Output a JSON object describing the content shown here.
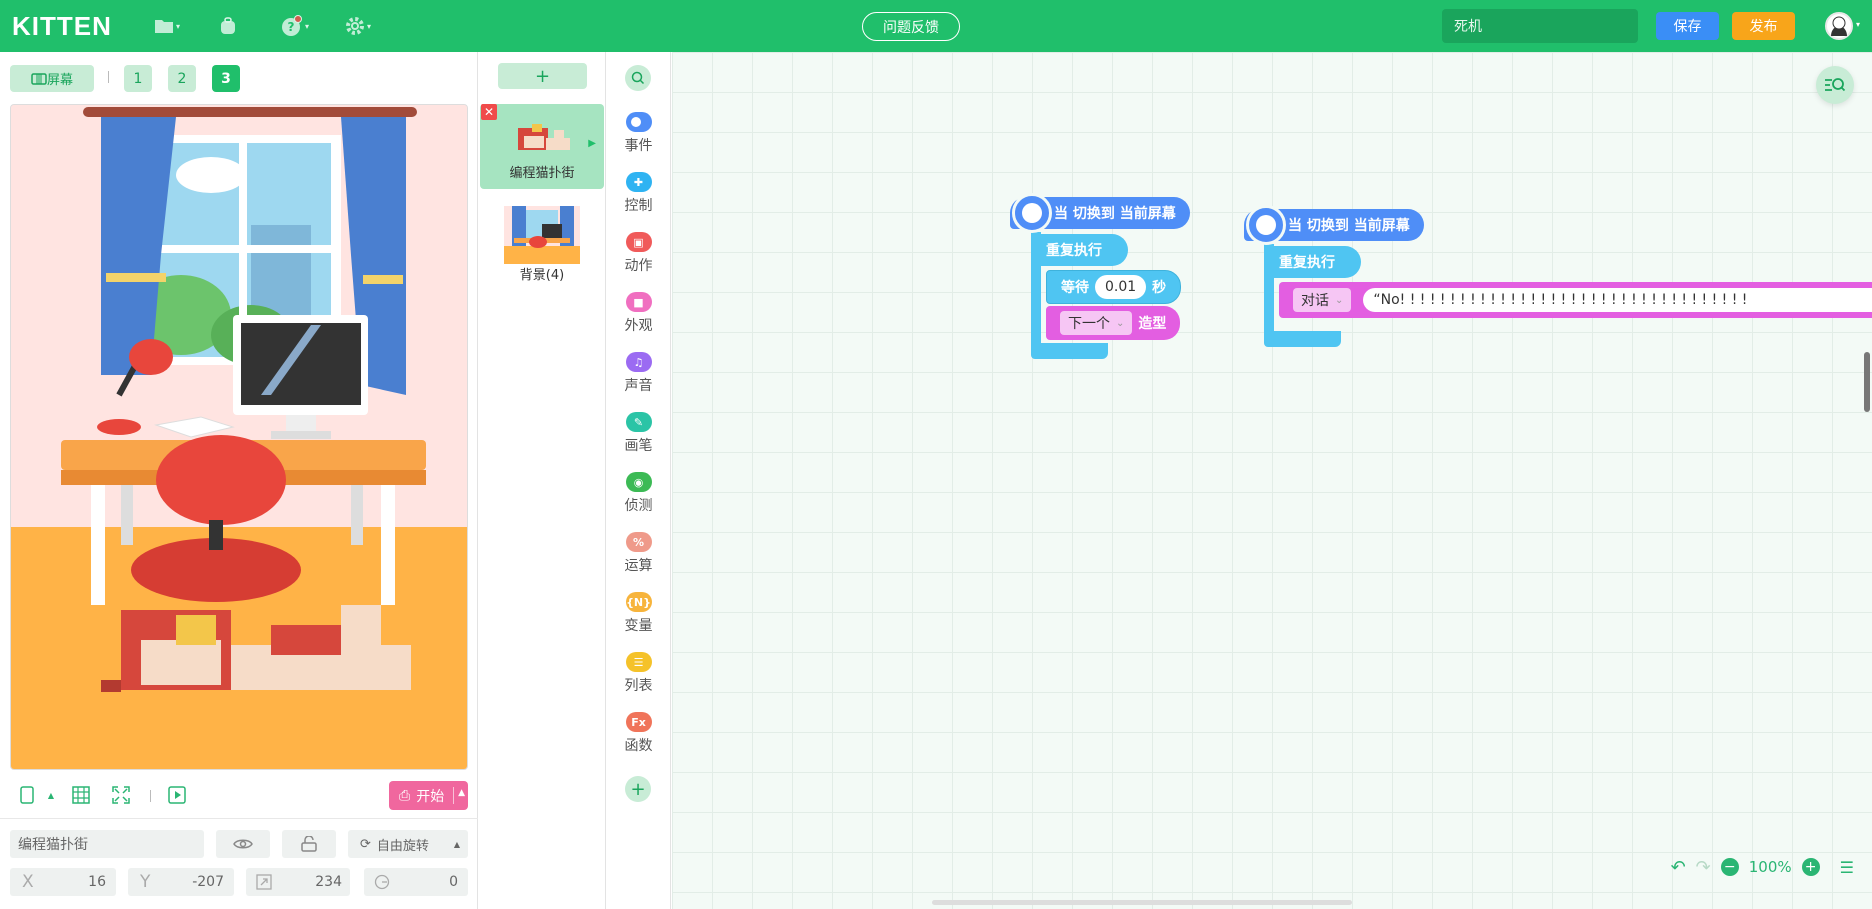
{
  "app": {
    "logo": "KITTEN",
    "feedback": "问题反馈",
    "project_name": "死机",
    "save": "保存",
    "publish": "发布"
  },
  "stage": {
    "screen_label": "屏幕",
    "tabs": [
      "1",
      "2",
      "3"
    ],
    "active_tab": "3",
    "start": "开始"
  },
  "sprite_props": {
    "name": "编程猫扑街",
    "rotation_mode": "自由旋转",
    "x_label": "X",
    "x": "16",
    "y_label": "Y",
    "y": "-207",
    "size": "234",
    "direction": "0"
  },
  "sprites": {
    "add": "+",
    "items": [
      {
        "label": "编程猫扑街"
      },
      {
        "label": "背景(4)"
      }
    ]
  },
  "categories": [
    {
      "label": "事件",
      "color": "#4f8ef7"
    },
    {
      "label": "控制",
      "color": "#2fb3f2"
    },
    {
      "label": "动作",
      "color": "#f05a5a"
    },
    {
      "label": "外观",
      "color": "#f06fc0"
    },
    {
      "label": "声音",
      "color": "#9b6bf2"
    },
    {
      "label": "画笔",
      "color": "#2bc4a6"
    },
    {
      "label": "侦测",
      "color": "#3cba55"
    },
    {
      "label": "运算",
      "color": "#ef9a8a"
    },
    {
      "label": "变量",
      "color": "#f7b43c"
    },
    {
      "label": "列表",
      "color": "#f5c22a"
    },
    {
      "label": "函数",
      "color": "#f0745a"
    }
  ],
  "scripts": [
    {
      "hat": "当 切换到 当前屏幕",
      "repeat": "重复执行",
      "wait_label": "等待",
      "wait_value": "0.01",
      "wait_unit": "秒",
      "costume_dd": "下一个",
      "costume_label": "造型"
    },
    {
      "hat": "当 切换到 当前屏幕",
      "repeat": "重复执行",
      "say_dd": "对话",
      "say_text": "“No! ! ! ! ! ! ! ! ! ! ! ! ! ! ! ! ! ! ! ! ! ! ! ! ! ! ! ! ! ! ! ! ! ! !"
    }
  ],
  "zoom": "100%"
}
